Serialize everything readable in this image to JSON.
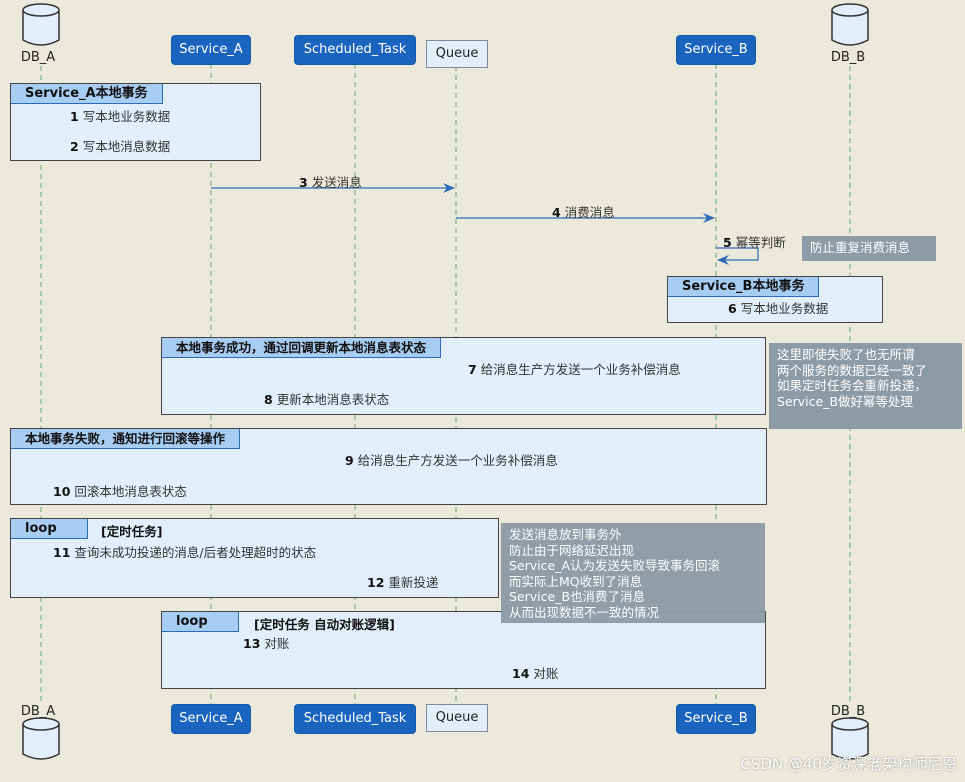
{
  "diagram": {
    "type": "sequence",
    "participants": [
      {
        "id": "db_a",
        "label": "DB_A",
        "kind": "database"
      },
      {
        "id": "service_a",
        "label": "Service_A",
        "kind": "participant"
      },
      {
        "id": "scheduled_task",
        "label": "Scheduled_Task",
        "kind": "participant"
      },
      {
        "id": "queue",
        "label": "Queue",
        "kind": "queue"
      },
      {
        "id": "service_b",
        "label": "Service_B",
        "kind": "participant"
      },
      {
        "id": "db_b",
        "label": "DB_B",
        "kind": "database"
      }
    ],
    "groups": [
      {
        "title": "Service_A本地事务",
        "condition": ""
      },
      {
        "title": "Service_B本地事务",
        "condition": ""
      },
      {
        "title": "本地事务成功，通过回调更新本地消息表状态",
        "condition": ""
      },
      {
        "title": "本地事务失败，通知进行回滚等操作",
        "condition": ""
      },
      {
        "title": "loop",
        "condition": "[定时任务]"
      },
      {
        "title": "loop",
        "condition": "[定时任务  自动对账逻辑]"
      }
    ],
    "messages": [
      {
        "num": "1",
        "text": "写本地业务数据",
        "from": "service_a",
        "to": "db_a"
      },
      {
        "num": "2",
        "text": "写本地消息数据",
        "from": "service_a",
        "to": "db_a"
      },
      {
        "num": "3",
        "text": "发送消息",
        "from": "service_a",
        "to": "queue"
      },
      {
        "num": "4",
        "text": "消费消息",
        "from": "queue",
        "to": "service_b"
      },
      {
        "num": "5",
        "text": "幂等判断",
        "from": "service_b",
        "to": "service_b"
      },
      {
        "num": "6",
        "text": "写本地业务数据",
        "from": "service_b",
        "to": "db_b"
      },
      {
        "num": "7",
        "text": "给消息生产方发送一个业务补偿消息",
        "from": "service_b",
        "to": "queue"
      },
      {
        "num": "8",
        "text": "更新本地消息表状态",
        "from": "queue",
        "to": "service_a"
      },
      {
        "num": "9",
        "text": "给消息生产方发送一个业务补偿消息",
        "from": "service_b",
        "to": "service_a"
      },
      {
        "num": "10",
        "text": "回滚本地消息表状态",
        "from": "service_a",
        "to": "db_a"
      },
      {
        "num": "11",
        "text": "查询未成功投递的消息/后者处理超时的状态",
        "from": "scheduled_task",
        "to": "db_a"
      },
      {
        "num": "12",
        "text": "重新投递",
        "from": "scheduled_task",
        "to": "queue"
      },
      {
        "num": "13",
        "text": "对账",
        "from": "scheduled_task",
        "to": "service_a"
      },
      {
        "num": "14",
        "text": "对账",
        "from": "scheduled_task",
        "to": "service_b"
      }
    ],
    "notes": [
      {
        "lines": [
          "防止重复消费消息"
        ]
      },
      {
        "lines": [
          "这里即使失败了也无所谓",
          "两个服务的数据已经一致了",
          "如果定时任务会重新投递，",
          "Service_B做好幂等处理"
        ]
      },
      {
        "lines": [
          "发送消息放到事务外",
          "防止由于网络延迟出现",
          "Service_A认为发送失败导致事务回滚",
          "而实际上MQ收到了消息",
          "Service_B也消费了消息",
          "从而出现数据不一致的情况"
        ]
      }
    ],
    "colors": {
      "background": "#ebe9db",
      "participant_fill": "#1a64c0",
      "arrow": "#2b6bb8",
      "group_fill": "#e2eefb",
      "group_tab": "#a8cdf2",
      "note_fill": "#8d9ba6",
      "lifeline": "#6aa86a"
    }
  },
  "watermark": "CSDN @40岁资深老架构师尼恩"
}
